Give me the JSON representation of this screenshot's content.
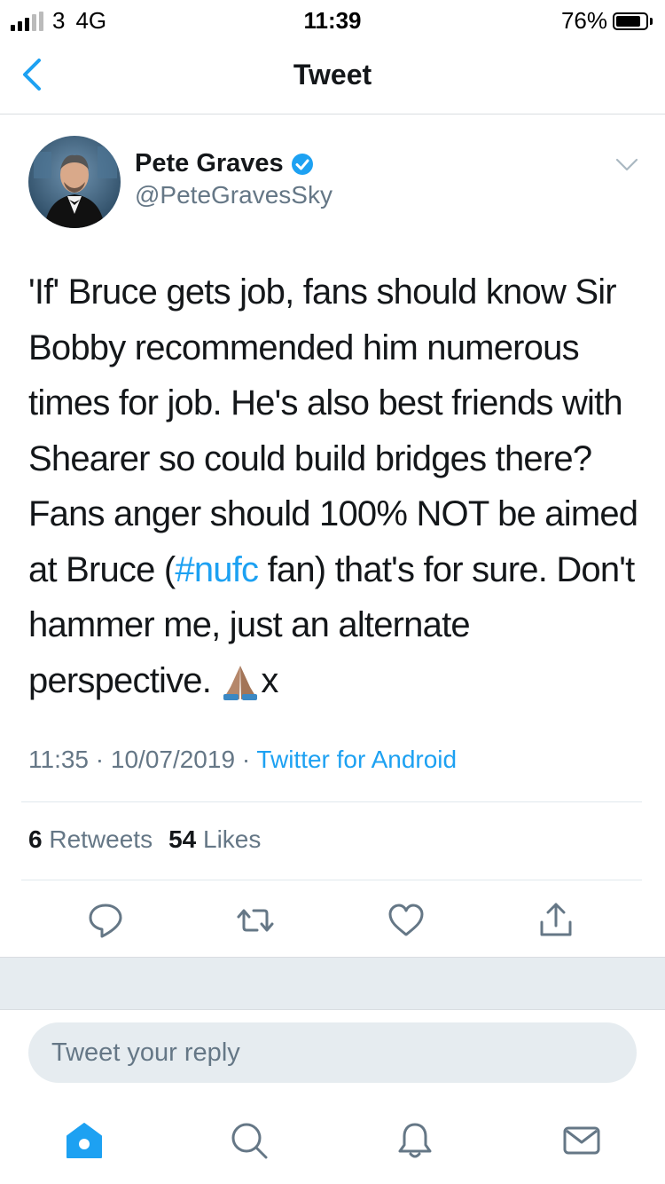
{
  "status_bar": {
    "carrier": "3",
    "network": "4G",
    "time": "11:39",
    "battery": "76%",
    "battery_level": 0.76
  },
  "nav": {
    "title": "Tweet",
    "back_icon": "chevron-left-icon"
  },
  "author": {
    "name": "Pete Graves",
    "handle": "@PeteGravesSky",
    "verified": true
  },
  "tweet": {
    "text_before_hashtag": "'If' Bruce gets job, fans should know Sir Bobby recommended him numerous times for job. He's also best friends with Shearer so could build bridges there? Fans anger should 100% NOT be aimed at Bruce (",
    "hashtag": "#nufc",
    "text_after_hashtag": " fan) that's for sure. Don't hammer me, just an alternate perspective. ",
    "emoji": "folded-hands-emoji",
    "text_end": "x"
  },
  "meta": {
    "time": "11:35",
    "date": "10/07/2019",
    "separator": "·",
    "source": "Twitter for Android"
  },
  "stats": {
    "retweets_count": "6",
    "retweets_label": "Retweets",
    "likes_count": "54",
    "likes_label": "Likes"
  },
  "actions": [
    "reply-icon",
    "retweet-icon",
    "like-icon",
    "share-icon"
  ],
  "reply": {
    "placeholder": "Tweet your reply"
  },
  "tabbar": [
    "home-icon",
    "search-icon",
    "notifications-icon",
    "messages-icon"
  ],
  "colors": {
    "accent": "#1da1f2",
    "secondary_text": "#657786",
    "primary_text": "#14171a",
    "divider": "#e1e8ed",
    "band": "#e6ecf0"
  }
}
